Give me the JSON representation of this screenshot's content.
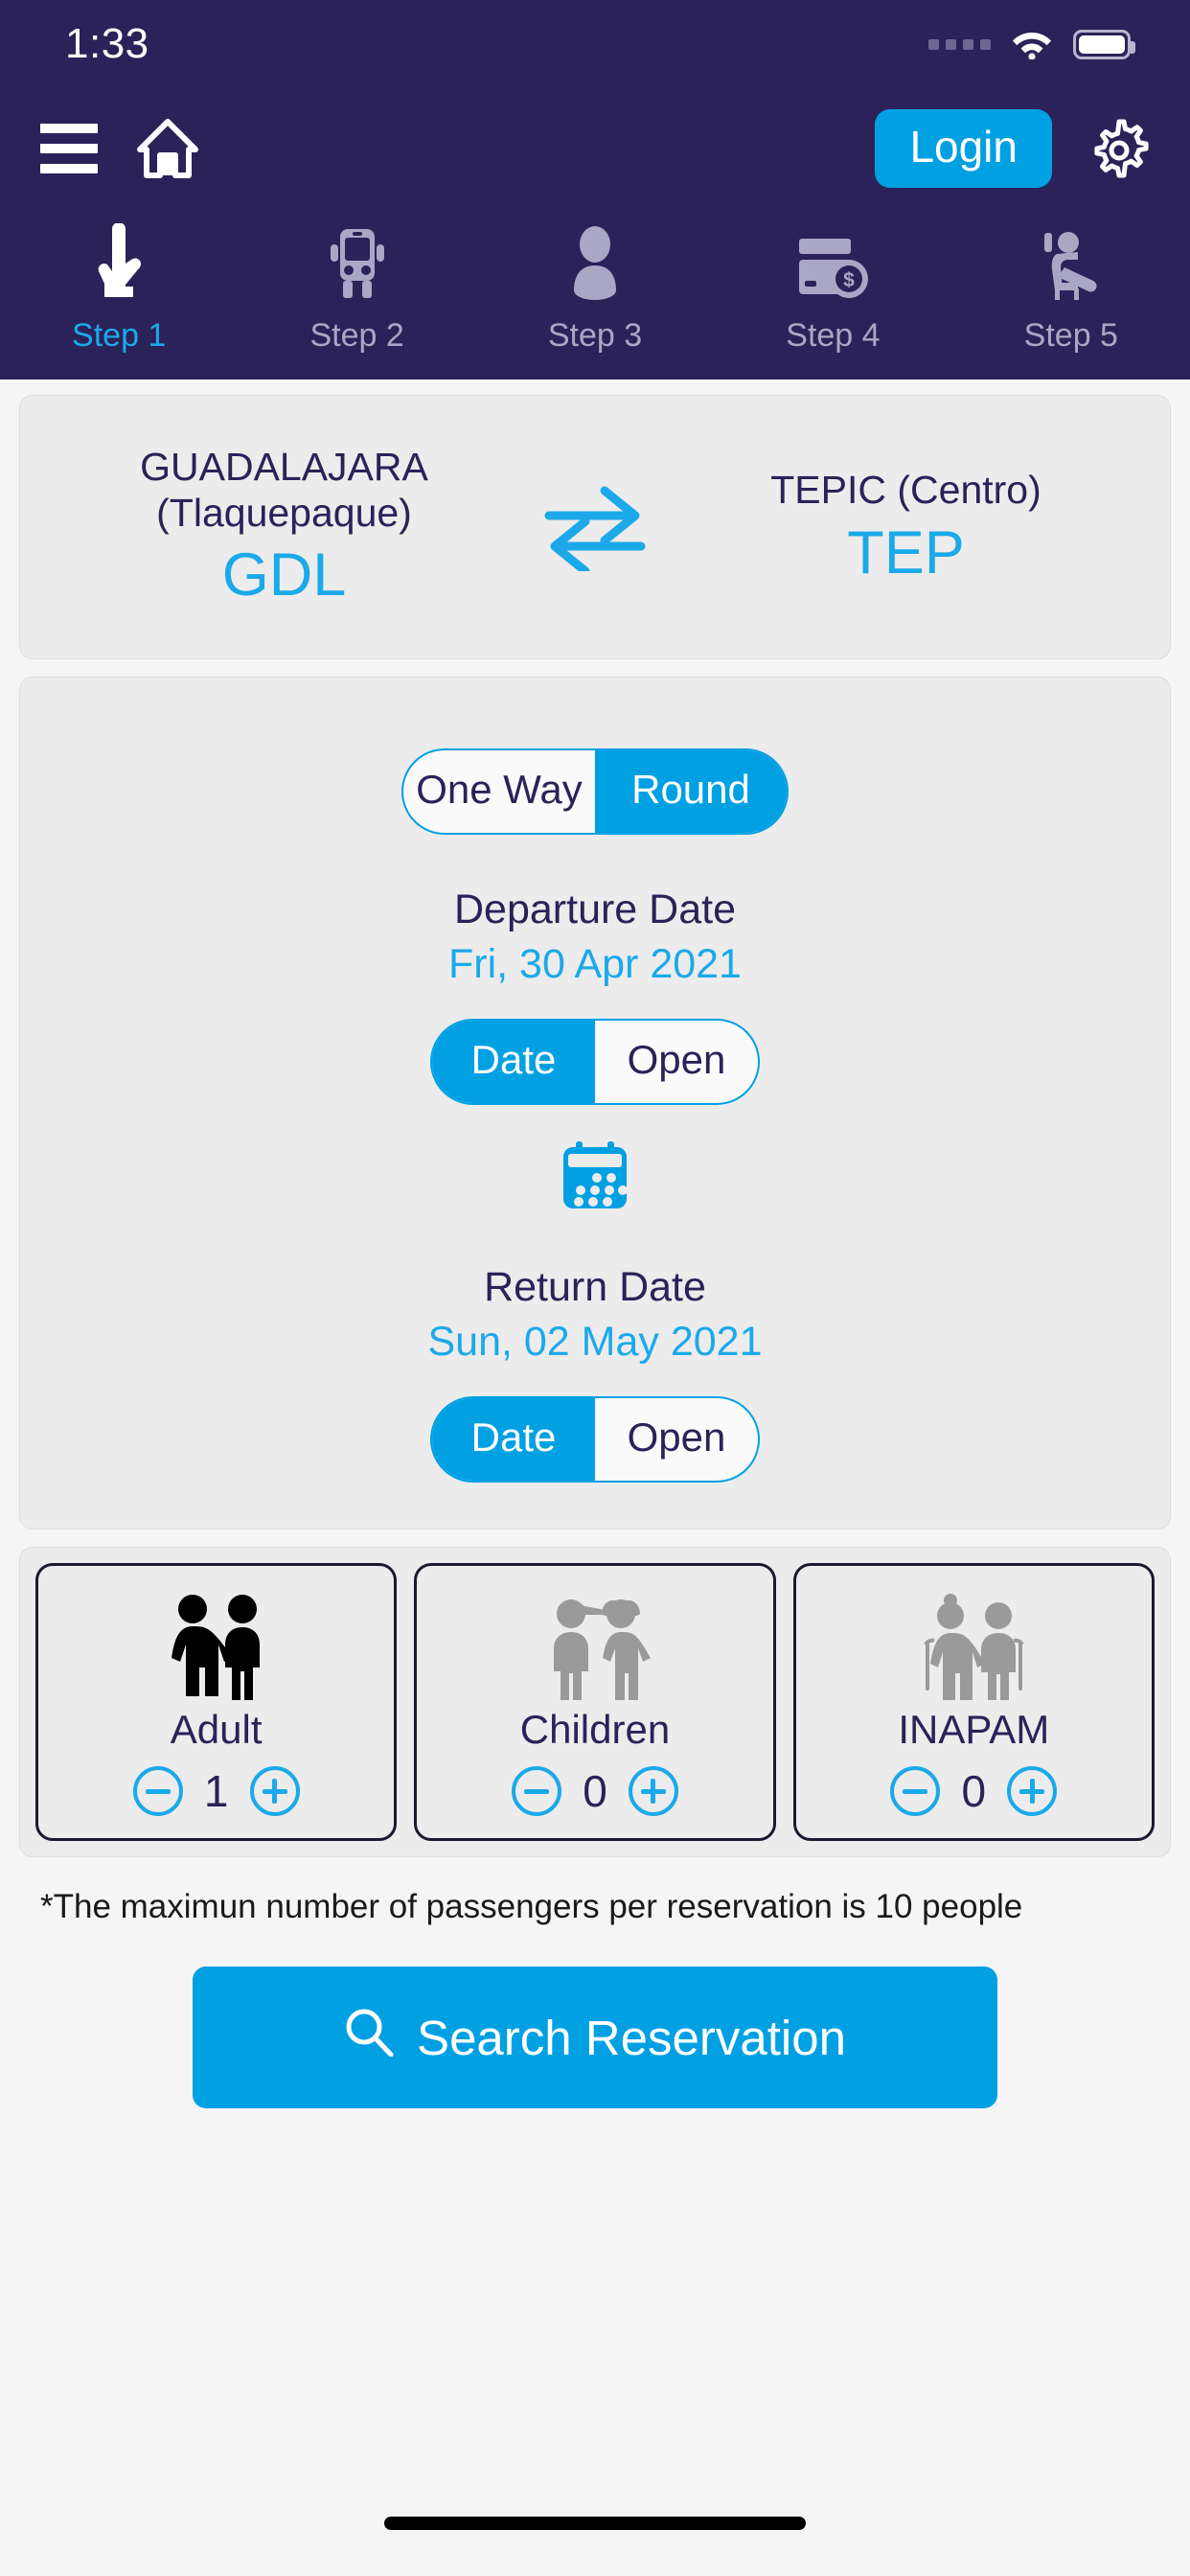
{
  "status_bar": {
    "time": "1:33",
    "signal_icon": "signal-dots-icon",
    "wifi_icon": "wifi-icon",
    "battery_icon": "battery-full-icon"
  },
  "header": {
    "menu_icon": "hamburger-menu-icon",
    "home_icon": "home-icon",
    "login_label": "Login",
    "settings_icon": "gear-icon"
  },
  "steps": [
    {
      "label": "Step 1",
      "icon": "touch-hand-icon",
      "active": true
    },
    {
      "label": "Step 2",
      "icon": "bus-icon",
      "active": false
    },
    {
      "label": "Step 3",
      "icon": "person-icon",
      "active": false
    },
    {
      "label": "Step 4",
      "icon": "credit-card-money-icon",
      "active": false
    },
    {
      "label": "Step 5",
      "icon": "seat-passenger-icon",
      "active": false
    }
  ],
  "route": {
    "origin_city": "GUADALAJARA",
    "origin_detail": "(Tlaquepaque)",
    "origin_code": "GDL",
    "destination_city": "TEPIC (Centro)",
    "destination_code": "TEP",
    "swap_icon": "swap-arrows-icon"
  },
  "trip": {
    "type_options": [
      "One Way",
      "Round"
    ],
    "type_selected": "Round",
    "departure": {
      "label": "Departure Date",
      "value": "Fri, 30 Apr 2021",
      "mode_options": [
        "Date",
        "Open"
      ],
      "mode_selected": "Date"
    },
    "calendar_icon": "calendar-icon",
    "return": {
      "label": "Return Date",
      "value": "Sun, 02 May 2021",
      "mode_options": [
        "Date",
        "Open"
      ],
      "mode_selected": "Date"
    }
  },
  "passengers": [
    {
      "label": "Adult",
      "count": "1",
      "icon": "adult-couple-icon",
      "decrement_icon": "minus-circle-icon",
      "increment_icon": "plus-circle-icon"
    },
    {
      "label": "Children",
      "count": "0",
      "icon": "children-icon",
      "decrement_icon": "minus-circle-icon",
      "increment_icon": "plus-circle-icon"
    },
    {
      "label": "INAPAM",
      "count": "0",
      "icon": "seniors-icon",
      "decrement_icon": "minus-circle-icon",
      "increment_icon": "plus-circle-icon"
    }
  ],
  "footer": {
    "note": "*The maximun number of passengers per reservation is 10 people",
    "search_label": "Search Reservation",
    "search_icon": "search-icon",
    "home_indicator": "home-indicator-bar"
  },
  "colors": {
    "header_navy": "#2b2259",
    "accent_cyan": "#00a0e3",
    "link_cyan": "#1ba9ea",
    "page_bg": "#f5f5f5",
    "card_bg": "#ececec",
    "inactive_step": "#aaa6c6"
  }
}
